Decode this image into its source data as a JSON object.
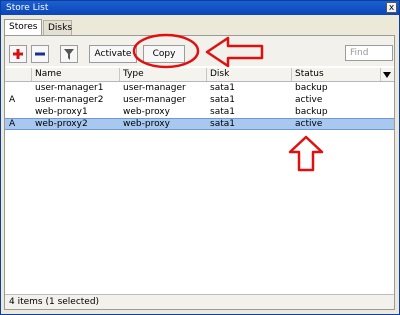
{
  "window": {
    "title": "Store List",
    "close_glyph": "x"
  },
  "tabs": [
    {
      "label": "Stores"
    },
    {
      "label": "Disks"
    }
  ],
  "toolbar": {
    "add_icon": "plus-icon",
    "remove_icon": "minus-icon",
    "filter_icon": "filter-icon",
    "activate_label": "Activate",
    "copy_label": "Copy",
    "find_placeholder": "Find"
  },
  "table": {
    "columns": [
      "Name",
      "Type",
      "Disk",
      "Status"
    ],
    "rows": [
      {
        "flag": "",
        "name": "user-manager1",
        "type": "user-manager",
        "disk": "sata1",
        "status": "backup",
        "selected": false
      },
      {
        "flag": "A",
        "name": "user-manager2",
        "type": "user-manager",
        "disk": "sata1",
        "status": "active",
        "selected": false
      },
      {
        "flag": "",
        "name": "web-proxy1",
        "type": "web-proxy",
        "disk": "sata1",
        "status": "backup",
        "selected": false
      },
      {
        "flag": "A",
        "name": "web-proxy2",
        "type": "web-proxy",
        "disk": "sata1",
        "status": "active",
        "selected": true
      }
    ]
  },
  "status_bar": {
    "text": "4 items (1 selected)"
  },
  "colors": {
    "annotation": "#e01010",
    "selection": "#a8c8f0",
    "titlebar": "#0a46b8"
  }
}
